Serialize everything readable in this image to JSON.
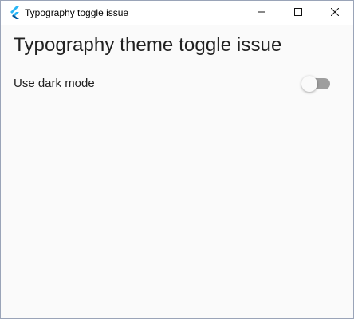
{
  "window": {
    "title": "Typography toggle issue",
    "app_icon": "flutter-icon",
    "controls": {
      "minimize_icon": "minimize-icon",
      "maximize_icon": "maximize-icon",
      "close_icon": "close-icon"
    }
  },
  "main": {
    "heading": "Typography theme toggle issue",
    "dark_mode_setting": {
      "label": "Use dark mode",
      "enabled": false
    }
  },
  "colors": {
    "accent_flutter_dark": "#01579b",
    "accent_flutter_light": "#29b6f6",
    "background": "#fafafa",
    "switch_track_off": "#9e9e9e"
  }
}
